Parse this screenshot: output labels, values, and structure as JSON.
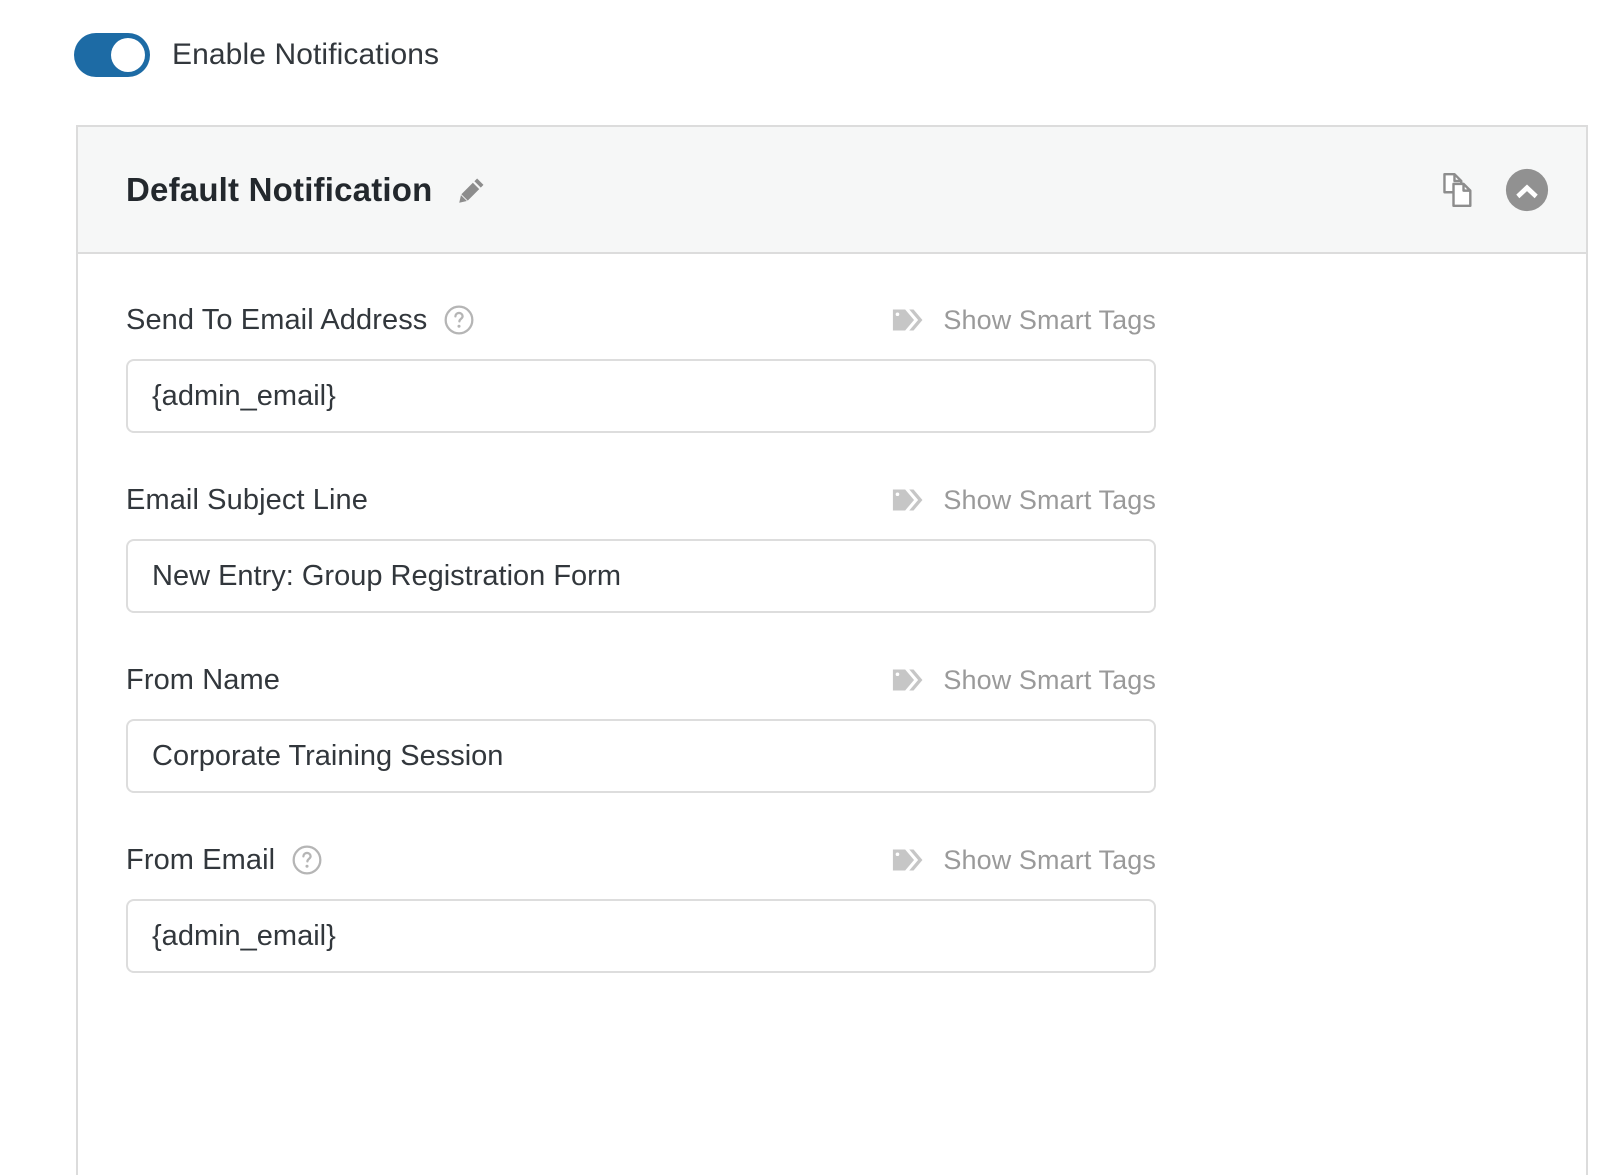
{
  "toggle": {
    "label": "Enable Notifications",
    "enabled": true,
    "accent_color": "#1d6ba5",
    "knob_color": "#ffffff",
    "icon": "toggle-on-icon"
  },
  "panel": {
    "title": "Default Notification",
    "edit_icon": "pencil-icon",
    "duplicate_icon": "duplicate-icon",
    "collapse_icon": "chevron-up-circle-icon",
    "header_bg": "#f6f7f7",
    "border_color": "#dcdcdc"
  },
  "smart_tags": {
    "label": "Show Smart Tags",
    "icon": "tags-icon",
    "color": "#9a9a9a"
  },
  "fields": [
    {
      "label": "Send To Email Address",
      "has_help": true,
      "help_icon": "question-circle-icon",
      "has_smart_tags": true,
      "value": "{admin_email}",
      "placeholder": "{admin_email}"
    },
    {
      "label": "Email Subject Line",
      "has_help": false,
      "has_smart_tags": true,
      "value": "New Entry: Group Registration Form",
      "placeholder": "Email Subject Line"
    },
    {
      "label": "From Name",
      "has_help": false,
      "has_smart_tags": true,
      "value": "Corporate Training Session",
      "placeholder": "From Name"
    },
    {
      "label": "From Email",
      "has_help": true,
      "help_icon": "question-circle-icon",
      "has_smart_tags": true,
      "value": "{admin_email}",
      "placeholder": "{admin_email}"
    }
  ]
}
